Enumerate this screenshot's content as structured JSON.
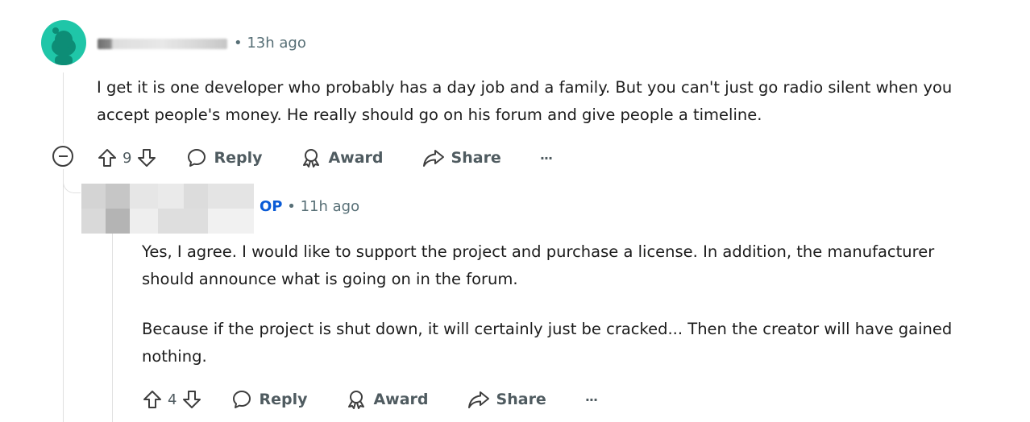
{
  "comment": {
    "time": "13h ago",
    "paragraphs": [
      "I get it is one developer who probably has a day job and a family. But you can't just go radio silent when you",
      "accept people's money. He really should go on his forum and give people a timeline."
    ],
    "votes": "9",
    "actions": {
      "reply": "Reply",
      "award": "Award",
      "share": "Share",
      "more": "···"
    }
  },
  "reply": {
    "op_badge": "OP",
    "time": "11h ago",
    "paragraphs": [
      "Yes, I agree. I would like to support the project and purchase a license. In addition, the manufacturer",
      "should announce what is going on in the forum.",
      "Because if the project is shut down, it will certainly just be cracked... Then the creator will have gained",
      "nothing."
    ],
    "votes": "4",
    "actions": {
      "reply": "Reply",
      "award": "Award",
      "share": "Share",
      "more": "···"
    }
  },
  "colors": {
    "avatar": "#1fc6a8",
    "op": "#0a5bd6",
    "meta": "#576f76"
  },
  "icons": [
    "snoo-avatar-icon",
    "collapse-icon",
    "upvote-icon",
    "downvote-icon",
    "comment-bubble-icon",
    "award-icon",
    "share-icon",
    "more-icon"
  ]
}
